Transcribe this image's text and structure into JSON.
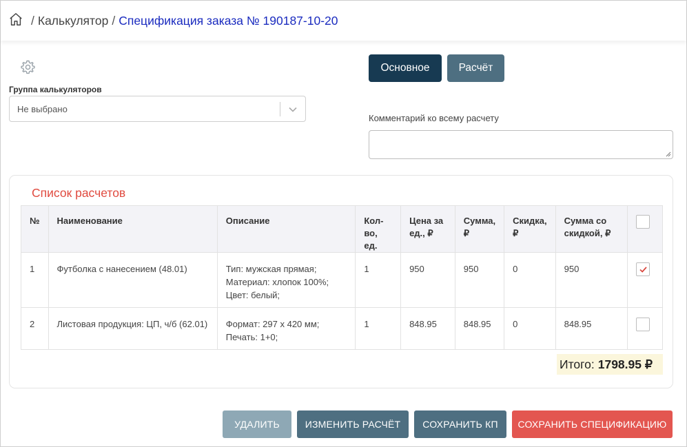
{
  "breadcrumb": {
    "items": [
      "Калькулятор"
    ],
    "current": "Спецификация заказа № 190187-10-20",
    "separator": "/"
  },
  "settings": {
    "group_label": "Группа калькуляторов",
    "group_value": "Не выбрано"
  },
  "tabs": {
    "main_label": "Основное",
    "calc_label": "Расчёт"
  },
  "comment": {
    "label": "Комментарий ко всему расчету",
    "value": ""
  },
  "calc_list": {
    "title": "Список расчетов",
    "columns": [
      "№",
      "Наименование",
      "Описание",
      "Кол-во, ед.",
      "Цена за ед., ₽",
      "Сумма, ₽",
      "Скидка, ₽",
      "Сумма со скидкой, ₽"
    ],
    "rows": [
      {
        "num": "1",
        "name": "Футболка с нанесением (48.01)",
        "desc": [
          "Тип: мужская прямая;",
          "Материал: хлопок 100%;",
          "Цвет: белый;"
        ],
        "qty": "1",
        "price": "950",
        "sum": "950",
        "discount": "0",
        "sum_discount": "950",
        "checked": true
      },
      {
        "num": "2",
        "name": "Листовая продукция: ЦП, ч/б (62.01)",
        "desc": [
          "Формат: 297 x 420 мм;",
          "Печать: 1+0;"
        ],
        "qty": "1",
        "price": "848.95",
        "sum": "848.95",
        "discount": "0",
        "sum_discount": "848.95",
        "checked": false
      }
    ],
    "total_label": "Итого:",
    "total_value": "1798.95 ₽"
  },
  "actions": {
    "delete_label": "УДАЛИТЬ",
    "edit_label": "ИЗМЕНИТЬ РАСЧЁТ",
    "save_kp_label": "СОХРАНИТЬ КП",
    "save_spec_label": "СОХРАНИТЬ СПЕЦИФИКАЦИЮ"
  },
  "colors": {
    "primary_dark": "#173a52",
    "secondary": "#4e6f81",
    "danger": "#e35650",
    "link": "#1a2bbf",
    "title_red": "#e04a3f",
    "total_bg": "#fbf6dc"
  },
  "icons": [
    "home-icon",
    "gear-icon",
    "chevron-down-icon",
    "checkmark-icon",
    "resize-grip-icon"
  ]
}
